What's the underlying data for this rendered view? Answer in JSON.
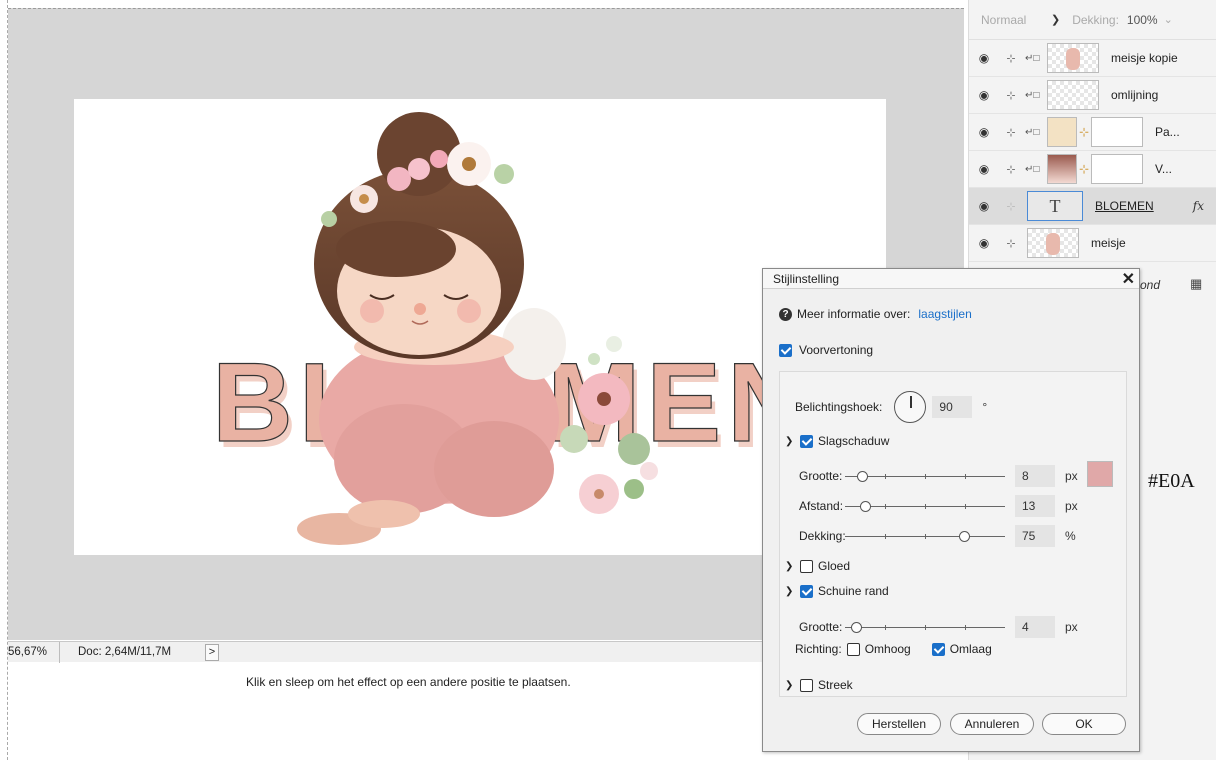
{
  "status": {
    "zoom": "56,67%",
    "doc": "Doc: 2,64M/11,7M",
    "arrow": ">"
  },
  "hint": "Klik en sleep om het effect op een andere positie te plaatsen.",
  "artwork": {
    "text": "BLOEMEN"
  },
  "layers_panel": {
    "blend_mode": "Normaal",
    "opacity_label": "Dekking:",
    "opacity_value": "100%",
    "layers": [
      {
        "name": "meisje kopie",
        "selected": false
      },
      {
        "name": "omlijning",
        "selected": false
      },
      {
        "name": "Pa...",
        "selected": false
      },
      {
        "name": "V...",
        "selected": false
      },
      {
        "name": "BLOEMEN",
        "selected": true,
        "fx": "fx"
      },
      {
        "name": "meisje",
        "selected": false
      }
    ],
    "background_label": "ond"
  },
  "dialog": {
    "title": "Stijlinstelling",
    "info_text": "Meer informatie over:",
    "info_link": "laagstijlen",
    "preview_label": "Voorvertoning",
    "angle_label": "Belichtingshoek:",
    "angle_value": "90",
    "angle_unit": "°",
    "drop_shadow": {
      "label": "Slagschaduw",
      "size_label": "Grootte:",
      "size_value": "8",
      "size_unit": "px",
      "distance_label": "Afstand:",
      "distance_value": "13",
      "distance_unit": "px",
      "opacity_label": "Dekking:",
      "opacity_value": "75",
      "opacity_unit": "%",
      "color": "#E0A8A8"
    },
    "glow_label": "Gloed",
    "bevel": {
      "label": "Schuine rand",
      "size_label": "Grootte:",
      "size_value": "4",
      "size_unit": "px",
      "direction_label": "Richting:",
      "up_label": "Omhoog",
      "down_label": "Omlaag"
    },
    "stroke_label": "Streek",
    "reset_button": "Herstellen",
    "cancel_button": "Annuleren",
    "ok_button": "OK"
  },
  "color_annotation": "#E0A"
}
